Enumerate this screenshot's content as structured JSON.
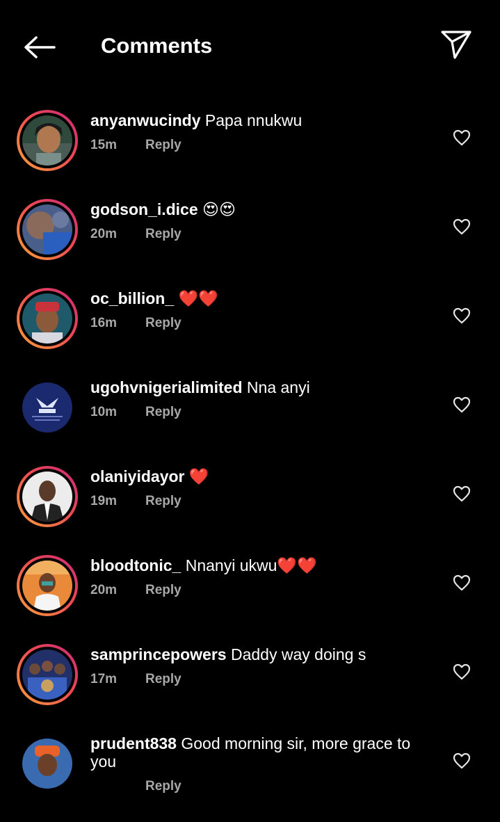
{
  "header": {
    "title": "Comments",
    "back_icon": "arrow-left-icon",
    "share_icon": "send-icon"
  },
  "reply_label": "Reply",
  "comments": [
    {
      "username": "anyanwucindy",
      "text": " Papa nnukwu",
      "time": "15m",
      "ring": true,
      "avatar": "woman-portrait"
    },
    {
      "username": "godson_i.dice",
      "text": " 😍😍",
      "time": "20m",
      "ring": true,
      "avatar": "blurred-blue"
    },
    {
      "username": "oc_billion_",
      "text": " ❤️❤️",
      "time": "16m",
      "ring": true,
      "avatar": "man-red-cap"
    },
    {
      "username": "ugohvnigerialimited",
      "text": " Nna anyi",
      "time": "10m",
      "ring": false,
      "avatar": "blue-logo"
    },
    {
      "username": "olaniyidayor",
      "text": " ❤️",
      "time": "19m",
      "ring": true,
      "avatar": "man-suit"
    },
    {
      "username": "bloodtonic_",
      "text": " Nnanyi ukwu❤️❤️",
      "time": "20m",
      "ring": true,
      "avatar": "man-orange-bg"
    },
    {
      "username": "samprincepowers",
      "text": " Daddy way doing s",
      "time": "17m",
      "ring": true,
      "avatar": "group-blue"
    },
    {
      "username": "prudent838",
      "text": " Good morning sir, more grace to you",
      "time": "",
      "ring": false,
      "avatar": "man-orange-hat"
    }
  ],
  "colors": {
    "background": "#000000",
    "text": "#ffffff",
    "muted": "#a8a8a8",
    "ring_start": "#f9a33a",
    "ring_end": "#c8287a"
  }
}
